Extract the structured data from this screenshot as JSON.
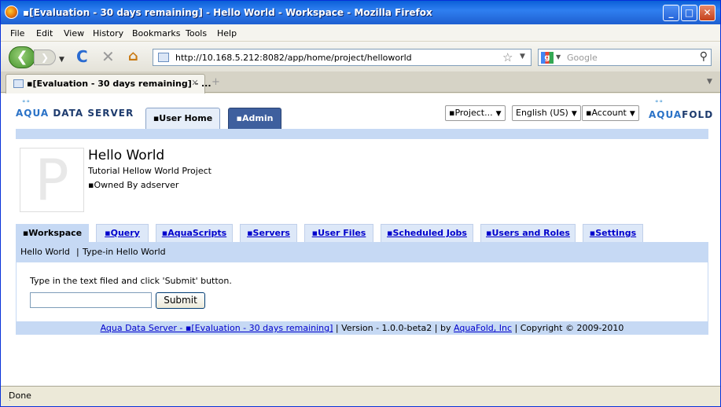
{
  "window": {
    "title": "▪[Evaluation - 30 days remaining] - Hello World - Workspace - Mozilla Firefox",
    "minimize_glyph": "_",
    "maximize_glyph": "□",
    "close_glyph": "✕"
  },
  "menubar": {
    "items": [
      "File",
      "Edit",
      "View",
      "History",
      "Bookmarks",
      "Tools",
      "Help"
    ]
  },
  "navbar": {
    "url": "http://10.168.5.212:8082/app/home/project/helloworld",
    "search_placeholder": "Google",
    "search_engine_glyph": "g"
  },
  "tabs": {
    "active_title": "▪[Evaluation - 30 days remaining] - ...",
    "new_tab_glyph": "+"
  },
  "app": {
    "logo_left": {
      "aqua": "AQUA",
      "rest": "DATA SERVER"
    },
    "logo_right": {
      "aqua": "AQUA",
      "rest": "FOLD"
    },
    "main_tabs": [
      "▪User Home",
      "▪Admin"
    ],
    "selects": {
      "project": "▪Project...",
      "language": "English (US)",
      "account": "▪Account"
    }
  },
  "project": {
    "icon_letter": "P",
    "title": "Hello World",
    "description": "Tutorial Hellow World Project",
    "owner": "▪Owned By adserver"
  },
  "workspace_tabs": [
    "▪Workspace",
    "▪Query",
    "▪AquaScripts",
    "▪Servers",
    "▪User Files",
    "▪Scheduled Jobs",
    "▪Users and Roles",
    "▪Settings"
  ],
  "breadcrumb": {
    "item1": "Hello World",
    "separator": "|",
    "item2": "Type-in Hello World"
  },
  "form": {
    "instruction": "Type in the text filed and click 'Submit' button.",
    "input_value": "",
    "submit_label": "Submit"
  },
  "footer": {
    "product_link": "Aqua Data Server - ▪[Evaluation - 30 days remaining]",
    "sep1": " | ",
    "version": "Version - 1.0.0-beta2",
    "sep2": " | by ",
    "company_link": "AquaFold, Inc",
    "copyright": " | Copyright © 2009-2010"
  },
  "status": {
    "text": "Done"
  },
  "colors": {
    "accent_blue": "#c6d9f4",
    "admin_tab": "#3e5f9e",
    "link": "#0000cc"
  }
}
